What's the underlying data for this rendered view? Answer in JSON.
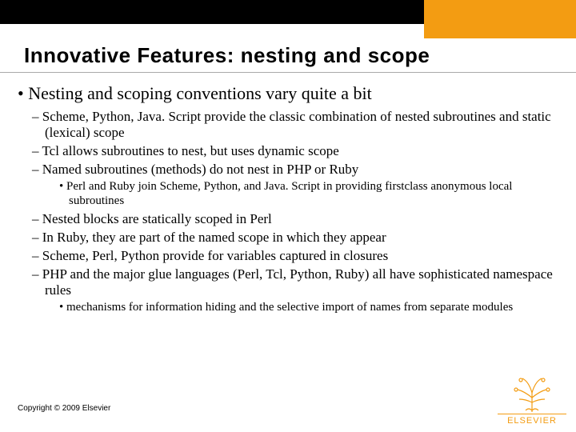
{
  "title": "Innovative Features: nesting and scope",
  "bullets": {
    "main": "Nesting and scoping conventions vary quite a bit",
    "sub": [
      "Scheme, Python, Java. Script provide the classic combination of nested subroutines and static (lexical) scope",
      "Tcl allows subroutines to nest, but uses dynamic scope",
      "Named subroutines (methods) do not nest in PHP or Ruby"
    ],
    "subsub1": "Perl and Ruby join Scheme, Python, and Java. Script in providing firstclass anonymous local subroutines",
    "sub2": [
      "Nested blocks are statically scoped in Perl",
      "In Ruby, they are part of the named scope in which they appear",
      "Scheme, Perl, Python provide for variables captured in closures",
      "PHP and the major glue languages (Perl, Tcl, Python, Ruby) all have sophisticated namespace rules"
    ],
    "subsub2": "mechanisms for information hiding and the selective import of names from separate modules"
  },
  "copyright": "Copyright © 2009 Elsevier",
  "logo": {
    "text": "ELSEVIER"
  }
}
